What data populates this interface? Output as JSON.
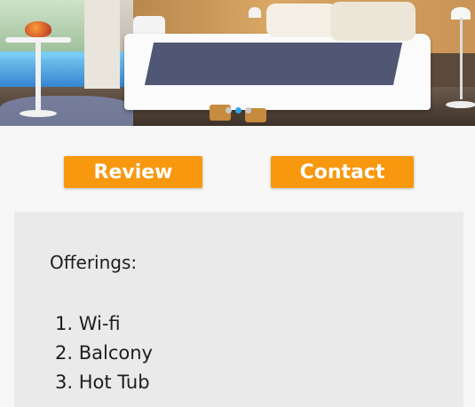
{
  "hero": {
    "image_alt": "Hotel room with bed",
    "carousel": {
      "slides": 3,
      "active_index": 1
    }
  },
  "actions": {
    "review_label": "Review",
    "contact_label": "Contact",
    "accent_color": "#f7980f"
  },
  "offerings": {
    "title": "Offerings:",
    "items": [
      "1. Wi-fi",
      "2. Balcony",
      "3. Hot Tub"
    ]
  }
}
